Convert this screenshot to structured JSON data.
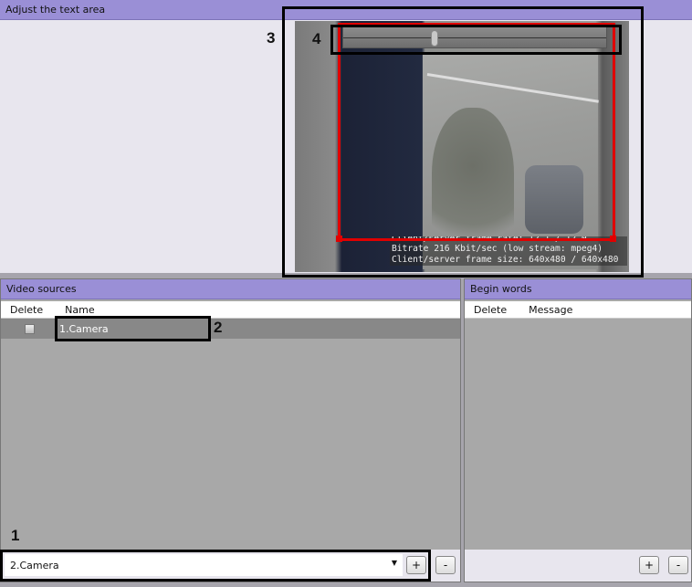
{
  "top_panel": {
    "title": "Adjust the text area"
  },
  "video": {
    "overlay_lines": [
      "Client/server frame rate: 12.1 / 12.0",
      "Bitrate 216 Kbit/sec (low stream: mpeg4)",
      "Client/server frame size: 640x480 / 640x480"
    ],
    "slider_position": 0.34,
    "text_area_color": "#e00000"
  },
  "video_sources": {
    "title": "Video sources",
    "columns": [
      "Delete",
      "Name"
    ],
    "rows": [
      {
        "delete": false,
        "name": "1.Camera"
      }
    ],
    "combo_value": "2.Camera",
    "add_label": "+",
    "remove_label": "-"
  },
  "begin_words": {
    "title": "Begin words",
    "columns": [
      "Delete",
      "Message"
    ],
    "add_label": "+",
    "remove_label": "-"
  },
  "callouts": [
    "1",
    "2",
    "3",
    "4"
  ],
  "colors": {
    "header": "#9a8fd6",
    "selected_row": "#888888"
  }
}
